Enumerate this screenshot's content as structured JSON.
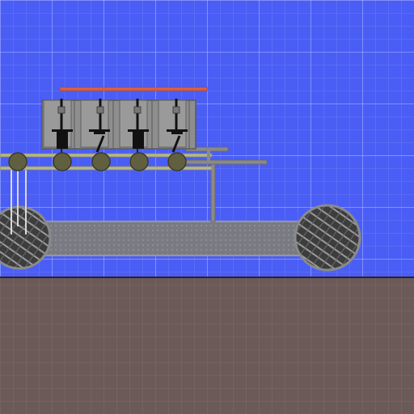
{
  "scene": {
    "type": "physics-sandbox",
    "grid_visible": true
  },
  "colors": {
    "sky": "#4a5ef5",
    "grid_fine": "#7f8cf5",
    "grid_major": "#b8c0ff",
    "ground": "#6b5a58",
    "ground_edge": "#2a2224",
    "ground_grid": "#8a7876",
    "metal": "#8a8a8a",
    "metal_dark": "#5a5a5a",
    "rod_accent": "#e0603a",
    "wheel_rim": "#6a6a6a",
    "wheel_mesh": "#444444",
    "small_wheel": "#606040",
    "rail": "#c8c890"
  },
  "objects": {
    "pistons": 4,
    "small_wheels": 5,
    "large_wheels": 2
  }
}
